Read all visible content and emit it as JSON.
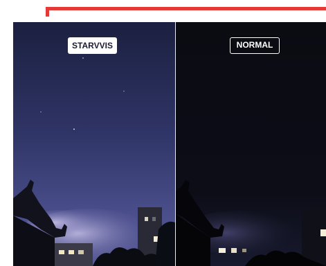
{
  "comparison": {
    "left_label": "STARVVIS",
    "right_label": "NORMAL"
  },
  "colors": {
    "accent_frame": "#e53935",
    "starvvis_sky_top": "#1e2346",
    "starvvis_sky_bottom": "#4a4f8e",
    "normal_sky": "#0a0a14"
  }
}
